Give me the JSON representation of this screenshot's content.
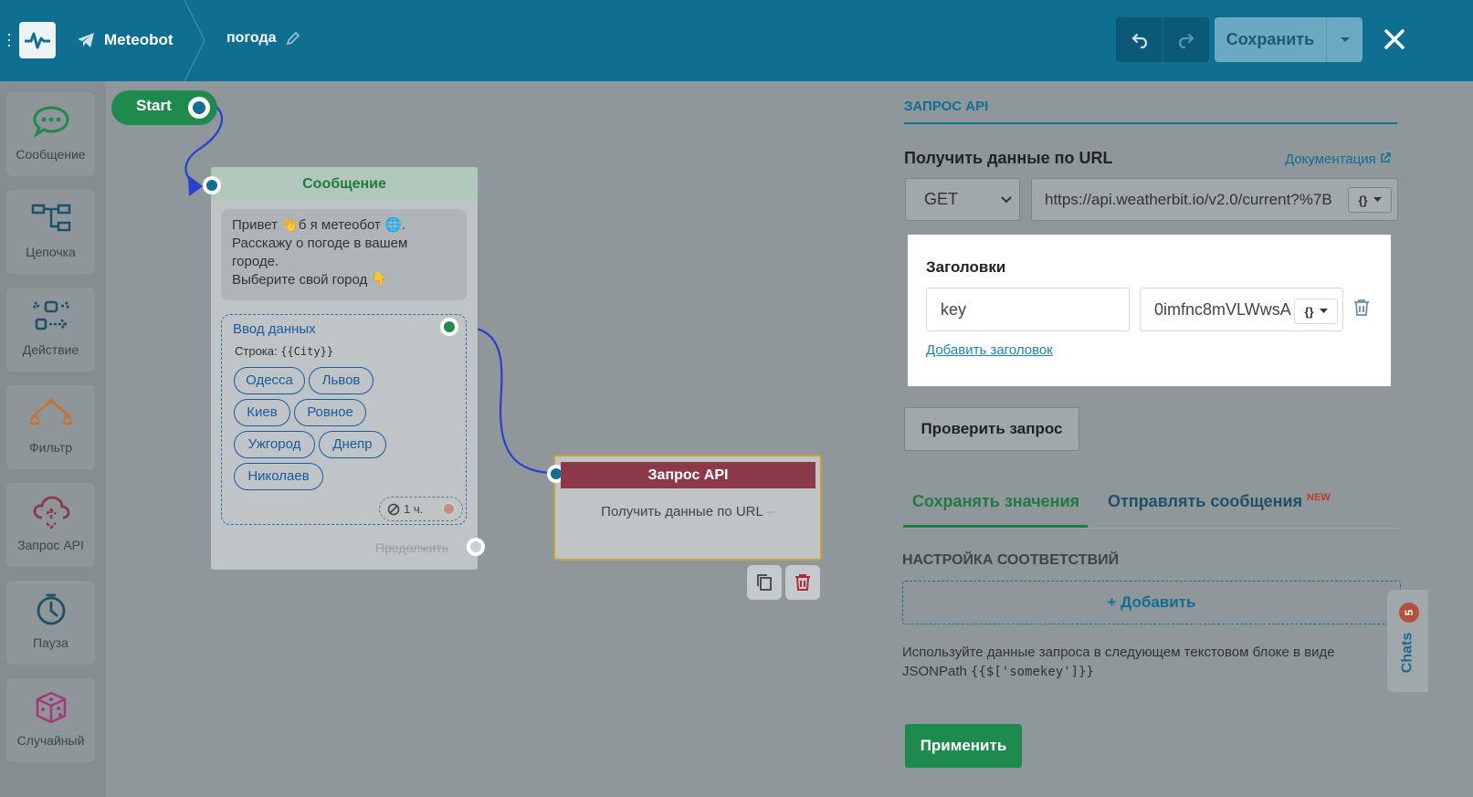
{
  "topbar": {
    "bot_name": "Meteobot",
    "flow_name": "погода",
    "save_label": "Сохранить"
  },
  "sidebar": {
    "items": [
      {
        "label": "Сообщение",
        "icon": "chat-bubble-icon"
      },
      {
        "label": "Цепочка",
        "icon": "chain-icon"
      },
      {
        "label": "Действие",
        "icon": "action-icon"
      },
      {
        "label": "Фильтр",
        "icon": "filter-icon"
      },
      {
        "label": "Запрос API",
        "icon": "cloud-api-icon"
      },
      {
        "label": "Пауза",
        "icon": "clock-icon"
      },
      {
        "label": "Случайный",
        "icon": "dice-icon"
      }
    ]
  },
  "canvas": {
    "start_label": "Start",
    "message_node": {
      "title": "Сообщение",
      "text_lines": [
        "Привет 👋б я метеобот 🌐.",
        "Расскажу о погоде в вашем",
        "городе.",
        "Выберите свой город 👇"
      ],
      "input": {
        "title": "Ввод данных",
        "type_label": "Строка:",
        "variable": "{{City}}",
        "chips": [
          "Одесса",
          "Львов",
          "Киев",
          "Ровное",
          "Ужгород",
          "Днепр",
          "Николаев"
        ],
        "timeout": "1 ч."
      },
      "continue_label": "Продолжить"
    },
    "api_node": {
      "title": "Запрос API",
      "description": "Получить данные по URL"
    }
  },
  "panel": {
    "tab_title": "ЗАПРОС API",
    "url_label": "Получить данные по URL",
    "docs_link": "Документация",
    "method": "GET",
    "url": "https://api.weatherbit.io/v2.0/current?%7B",
    "var_button": "{}",
    "headers": {
      "title": "Заголовки",
      "key": "key",
      "value": "0imfnc8mVLWwsA",
      "add_label": "Добавить заголовок"
    },
    "check_label": "Проверить запрос",
    "tabs": [
      {
        "label": "Сохранять значения"
      },
      {
        "label": "Отправлять сообщения",
        "badge": "NEW"
      }
    ],
    "mapping_title": "НАСТРОЙКА СООТВЕТСТВИЙ",
    "add_mapping_label": "+ Добавить",
    "hint_text": "Используйте данные запроса в следующем текстовом блоке в виде JSONPath",
    "hint_code": "{{$['somekey']}}",
    "apply_label": "Применить"
  },
  "chats": {
    "label": "Chats",
    "count": "5"
  }
}
